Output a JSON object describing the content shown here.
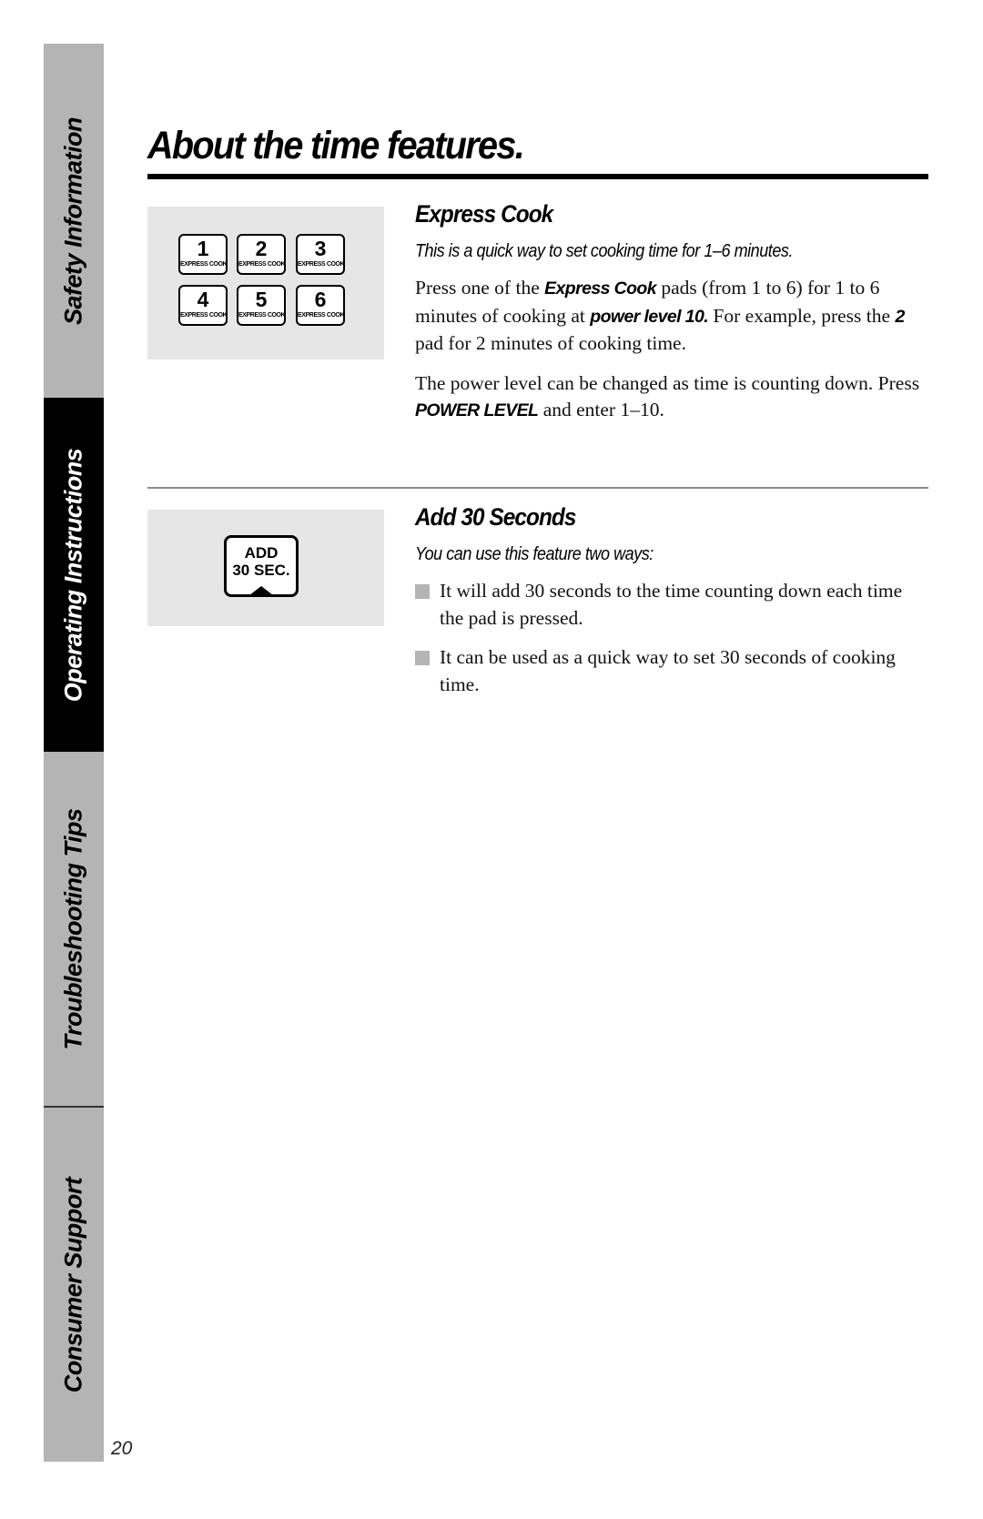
{
  "sidebar": {
    "tabs": [
      {
        "label": "Safety Information",
        "active": false
      },
      {
        "label": "Operating Instructions",
        "active": true
      },
      {
        "label": "Troubleshooting Tips",
        "active": false
      },
      {
        "label": "Consumer Support",
        "active": false
      }
    ]
  },
  "page": {
    "title": "About the time features.",
    "number": "20"
  },
  "express_cook": {
    "heading": "Express Cook",
    "lead": "This is a quick way to set cooking time for 1–6 minutes.",
    "para1": {
      "t1": "Press one of the ",
      "em1": "Express Cook",
      "t2": "  pads (from 1 to 6) for 1 to 6 minutes of cooking at ",
      "em2": "power level 10.",
      "t3": "  For example, press the ",
      "em3": "2",
      "t4": "  pad for 2 minutes of cooking time."
    },
    "para2": {
      "t1": "The power level can be changed as time is counting down. Press ",
      "em1": "POWER LEVEL",
      "t2": " and enter 1–10."
    },
    "pads": [
      {
        "number": "1",
        "label": "EXPRESS COOK"
      },
      {
        "number": "2",
        "label": "EXPRESS COOK"
      },
      {
        "number": "3",
        "label": "EXPRESS COOK"
      },
      {
        "number": "4",
        "label": "EXPRESS COOK"
      },
      {
        "number": "5",
        "label": "EXPRESS COOK"
      },
      {
        "number": "6",
        "label": "EXPRESS COOK"
      }
    ]
  },
  "add_30": {
    "heading": "Add 30 Seconds",
    "lead": "You can use this feature two ways:",
    "pad": {
      "line1": "ADD",
      "line2": "30 SEC."
    },
    "bullets": [
      "It will add 30 seconds to the time counting down each time the pad is pressed.",
      "It can be used as a quick way to set 30 seconds of cooking time."
    ]
  }
}
